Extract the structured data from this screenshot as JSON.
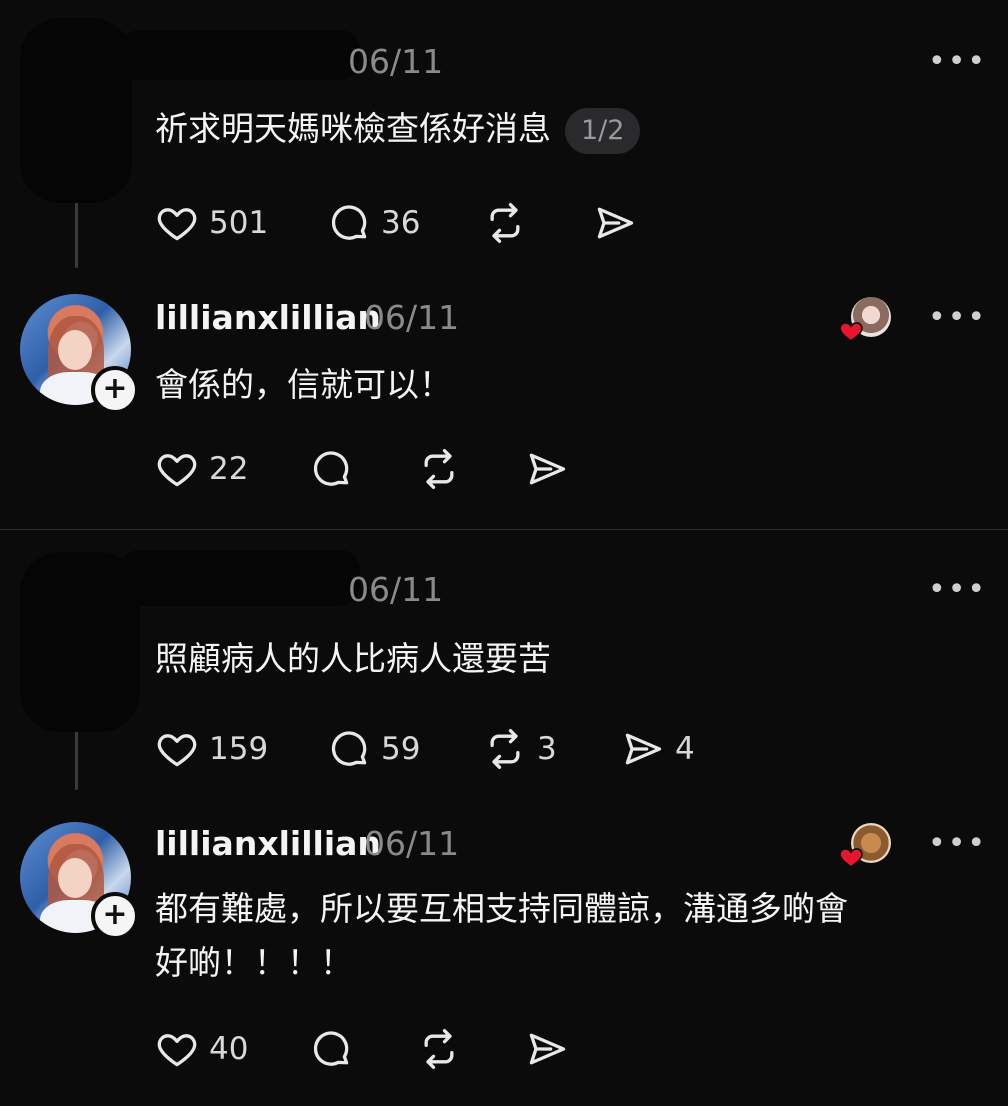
{
  "posts": [
    {
      "username": "",
      "date": "06/11",
      "text": "祈求明天媽咪檢查係好消息",
      "page_badge": "1/2",
      "likes": "501",
      "replies": "36",
      "reposts": "",
      "shares": ""
    },
    {
      "username": "lillianxlillian",
      "date": "06/11",
      "text": "會係的，信就可以！",
      "likes": "22",
      "replies": "",
      "reposts": "",
      "shares": ""
    },
    {
      "username": "",
      "date": "06/11",
      "text": "照顧病人的人比病人還要苦",
      "likes": "159",
      "replies": "59",
      "reposts": "3",
      "shares": "4"
    },
    {
      "username": "lillianxlillian",
      "date": "06/11",
      "text_line1": "都有難處，所以要互相支持同體諒，溝通多啲會",
      "text_line2": "好啲！！！！",
      "likes": "40",
      "replies": "",
      "reposts": "",
      "shares": ""
    }
  ],
  "ui": {
    "more": "•••",
    "follow": "+"
  },
  "colors": {
    "background": "#0b0b0c",
    "text": "#f4f4f4",
    "muted": "#8a8a8a",
    "heart_red": "#e8152f"
  },
  "icons": [
    "heart-icon",
    "reply-bubble-icon",
    "repost-icon",
    "send-icon",
    "more-icon",
    "plus-icon"
  ]
}
